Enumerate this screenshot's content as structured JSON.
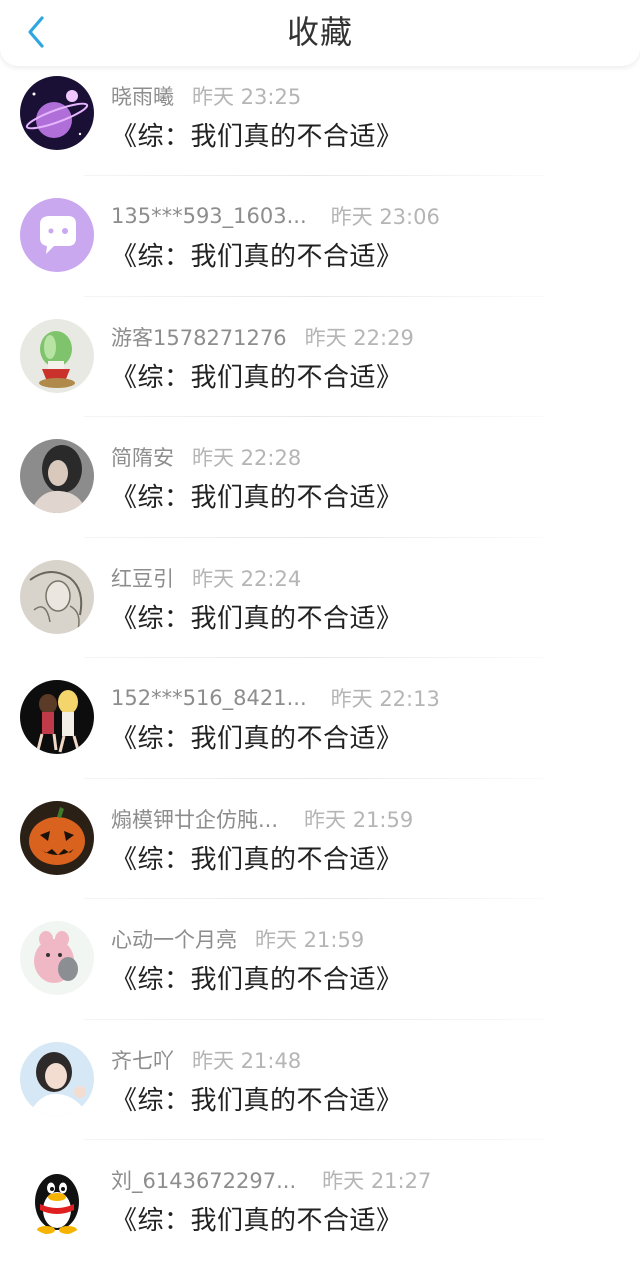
{
  "header": {
    "title": "收藏",
    "back_icon": "chevron-left-icon",
    "accent": "#2ea7e0"
  },
  "items": [
    {
      "name": "晓雨曦",
      "time": "昨天 23:25",
      "book": "《综：我们真的不合适》",
      "avatar": "planet-avatar"
    },
    {
      "name": "135***593_1603...",
      "time": "昨天 23:06",
      "book": "《综：我们真的不合适》",
      "avatar": "chat-bubble-avatar"
    },
    {
      "name": "游客1578271276",
      "time": "昨天 22:29",
      "book": "《综：我们真的不合适》",
      "avatar": "jade-cabbage-avatar"
    },
    {
      "name": "简隋安",
      "time": "昨天 22:28",
      "book": "《综：我们真的不合适》",
      "avatar": "portrait-girl-avatar"
    },
    {
      "name": "红豆引",
      "time": "昨天 22:24",
      "book": "《综：我们真的不合适》",
      "avatar": "sketch-avatar"
    },
    {
      "name": "152***516_8421...",
      "time": "昨天 22:13",
      "book": "《综：我们真的不合适》",
      "avatar": "anime-girls-avatar"
    },
    {
      "name": "煽模钾廿企仿肫...",
      "time": "昨天 21:59",
      "book": "《综：我们真的不合适》",
      "avatar": "pumpkin-avatar"
    },
    {
      "name": "心动一个月亮",
      "time": "昨天 21:59",
      "book": "《综：我们真的不合适》",
      "avatar": "pink-creature-avatar"
    },
    {
      "name": "齐七吖",
      "time": "昨天 21:48",
      "book": "《综：我们真的不合适》",
      "avatar": "photo-girl-avatar"
    },
    {
      "name": "刘_6143672297...",
      "time": "昨天 21:27",
      "book": "《综：我们真的不合适》",
      "avatar": "qq-penguin-avatar"
    }
  ]
}
